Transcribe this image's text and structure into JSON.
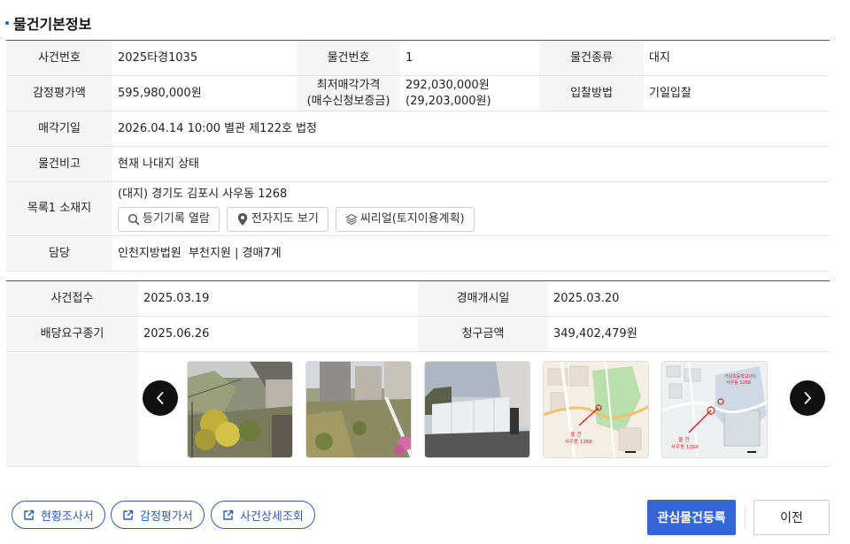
{
  "section_title": "물건기본정보",
  "basic_info": {
    "case_no_label": "사건번호",
    "case_no": "2025타경1035",
    "item_no_label": "물건번호",
    "item_no": "1",
    "item_type_label": "물건종류",
    "item_type": "대지",
    "appraisal_label": "감정평가액",
    "appraisal": "595,980,000원",
    "min_price_label_1": "최저매각가격",
    "min_price_label_2": "(매수신청보증금)",
    "min_price": "292,030,000원",
    "deposit": "(29,203,000원)",
    "bid_method_label": "입찰방법",
    "bid_method": "기일입찰",
    "sale_date_label": "매각기일",
    "sale_date": "2026.04.14 10:00 별관 제122호 법정",
    "remarks_label": "물건비고",
    "remarks": "현재 나대지 상태",
    "location_label": "목록1 소재지",
    "location": "(대지) 경기도 김포시 사우동 1268",
    "location_buttons": [
      {
        "label": "등기기록 열람",
        "icon": "search-icon"
      },
      {
        "label": "전자지도 보기",
        "icon": "map-pin-icon"
      },
      {
        "label": "씨리얼(토지이용계획)",
        "icon": "layers-icon"
      }
    ],
    "manager_label": "담당",
    "manager": "인천지방법원  부천지원 | 경매7계"
  },
  "case_info": {
    "receipt_label": "사건접수",
    "receipt": "2025.03.19",
    "start_label": "경매개시일",
    "start": "2025.03.20",
    "dividend_label": "배당요구종기",
    "dividend": "2025.06.26",
    "claim_label": "청구금액",
    "claim": "349,402,479원"
  },
  "map_labels": {
    "map1_line1": "물 건",
    "map1_line2": "사우동 1268",
    "map2_line1": "물 건",
    "map2_line2": "사우동 1268",
    "map2_top": "거남초등학교(지)",
    "map2_top2": "사우동 1268"
  },
  "bottom": {
    "survey_btn": "현황조사서",
    "appraisal_btn": "감정평가서",
    "detail_btn": "사건상세조회",
    "register_btn": "관심물건등록",
    "prev_btn": "이전"
  },
  "colors": {
    "primary": "#3565d6",
    "outline": "#2f5ca8",
    "header_bg": "#f5f5f5"
  }
}
